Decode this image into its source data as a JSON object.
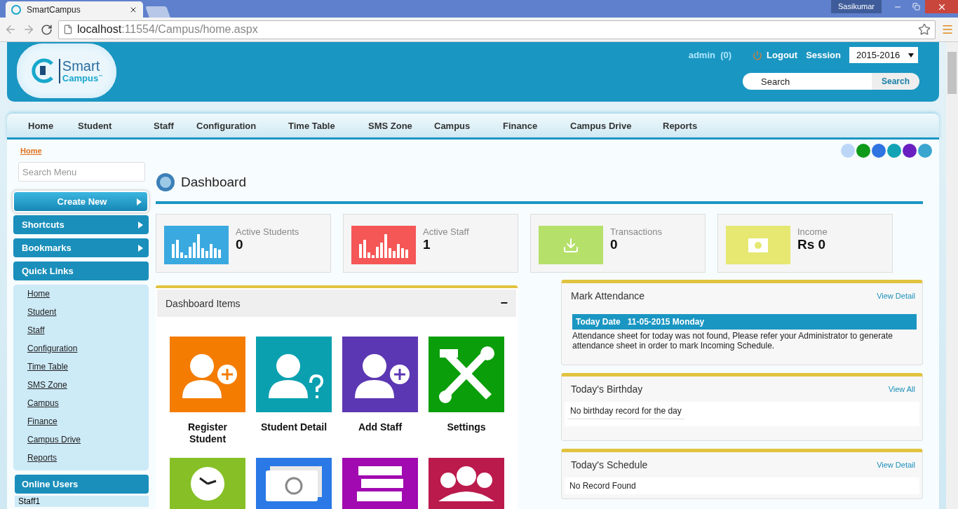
{
  "browser": {
    "tab_title": "SmartCampus",
    "user_badge": "Sasikumar",
    "address_host": "localhost",
    "address_path": ":11554/Campus/home.aspx"
  },
  "header": {
    "logo": {
      "line1": "Smart",
      "line2": "Campus",
      "mark": "™"
    },
    "user": "admin",
    "user_count": "(0)",
    "logout": "Logout",
    "session_label": "Session",
    "session_value": "2015-2016",
    "search_placeholder": "Search",
    "search_button": "Search"
  },
  "nav": [
    "Home",
    "Student",
    "Staff",
    "Configuration",
    "Time Table",
    "SMS Zone",
    "Campus",
    "Finance",
    "Campus Drive",
    "Reports"
  ],
  "breadcrumb": "Home",
  "theme_colors": [
    {
      "color": "#bcd6f8"
    },
    {
      "color": "#0f9a1a"
    },
    {
      "color": "#2f74e0"
    },
    {
      "color": "#12a3b4"
    },
    {
      "color": "#6a1fc0"
    },
    {
      "color": "#3aa6d0"
    }
  ],
  "sidebar": {
    "search_placeholder": "Search Menu",
    "menus": [
      {
        "label": "Create New",
        "kind": "primary"
      },
      {
        "label": "Shortcuts",
        "kind": "arrow"
      },
      {
        "label": "Bookmarks",
        "kind": "arrow"
      },
      {
        "label": "Quick Links",
        "kind": "plain"
      }
    ],
    "quick_links": [
      "Home",
      "Student",
      "Staff",
      "Configuration",
      "Time Table",
      "SMS Zone",
      "Campus",
      "Finance",
      "Campus Drive",
      "Reports"
    ],
    "online_users_title": "Online Users",
    "online_users": [
      "Staff1"
    ]
  },
  "dashboard": {
    "title": "Dashboard",
    "stats": [
      {
        "label": "Active Students",
        "value": "0",
        "color": "#3aa9e0",
        "kind": "bars"
      },
      {
        "label": "Active Staff",
        "value": "1",
        "color": "#f55656",
        "kind": "bars"
      },
      {
        "label": "Transactions",
        "value": "0",
        "color": "#b5e06a",
        "kind": "download"
      },
      {
        "label": "Income",
        "value": "Rs 0",
        "color": "#e6e872",
        "kind": "money"
      }
    ],
    "items_title": "Dashboard Items",
    "collapse": "−",
    "tiles": [
      {
        "label": "Register Student",
        "color": "#f47c00",
        "kind": "user-add"
      },
      {
        "label": "Student Detail",
        "color": "#0aa0b0",
        "kind": "user-question"
      },
      {
        "label": "Add Staff",
        "color": "#5c37b3",
        "kind": "user-add-round"
      },
      {
        "label": "Settings",
        "color": "#0a9e0a",
        "kind": "tools"
      },
      {
        "color": "#86c026",
        "kind": "clock"
      },
      {
        "color": "#2a79e6",
        "kind": "money"
      },
      {
        "color": "#a10ab0",
        "kind": "books"
      },
      {
        "color": "#bb1a4c",
        "kind": "group"
      }
    ]
  },
  "attendance": {
    "title": "Mark Attendance",
    "link": "View Detail",
    "date_label": "Today Date",
    "date": "11-05-2015 Monday",
    "message": "Attendance sheet for today was not found, Please refer your Administrator to generate attendance sheet in order to mark Incoming Schedule."
  },
  "birthday": {
    "title": "Today's Birthday",
    "link": "View All",
    "message": "No birthday record for the day"
  },
  "schedule": {
    "title": "Today's Schedule",
    "link": "View Detail",
    "message": "No Record Found"
  }
}
